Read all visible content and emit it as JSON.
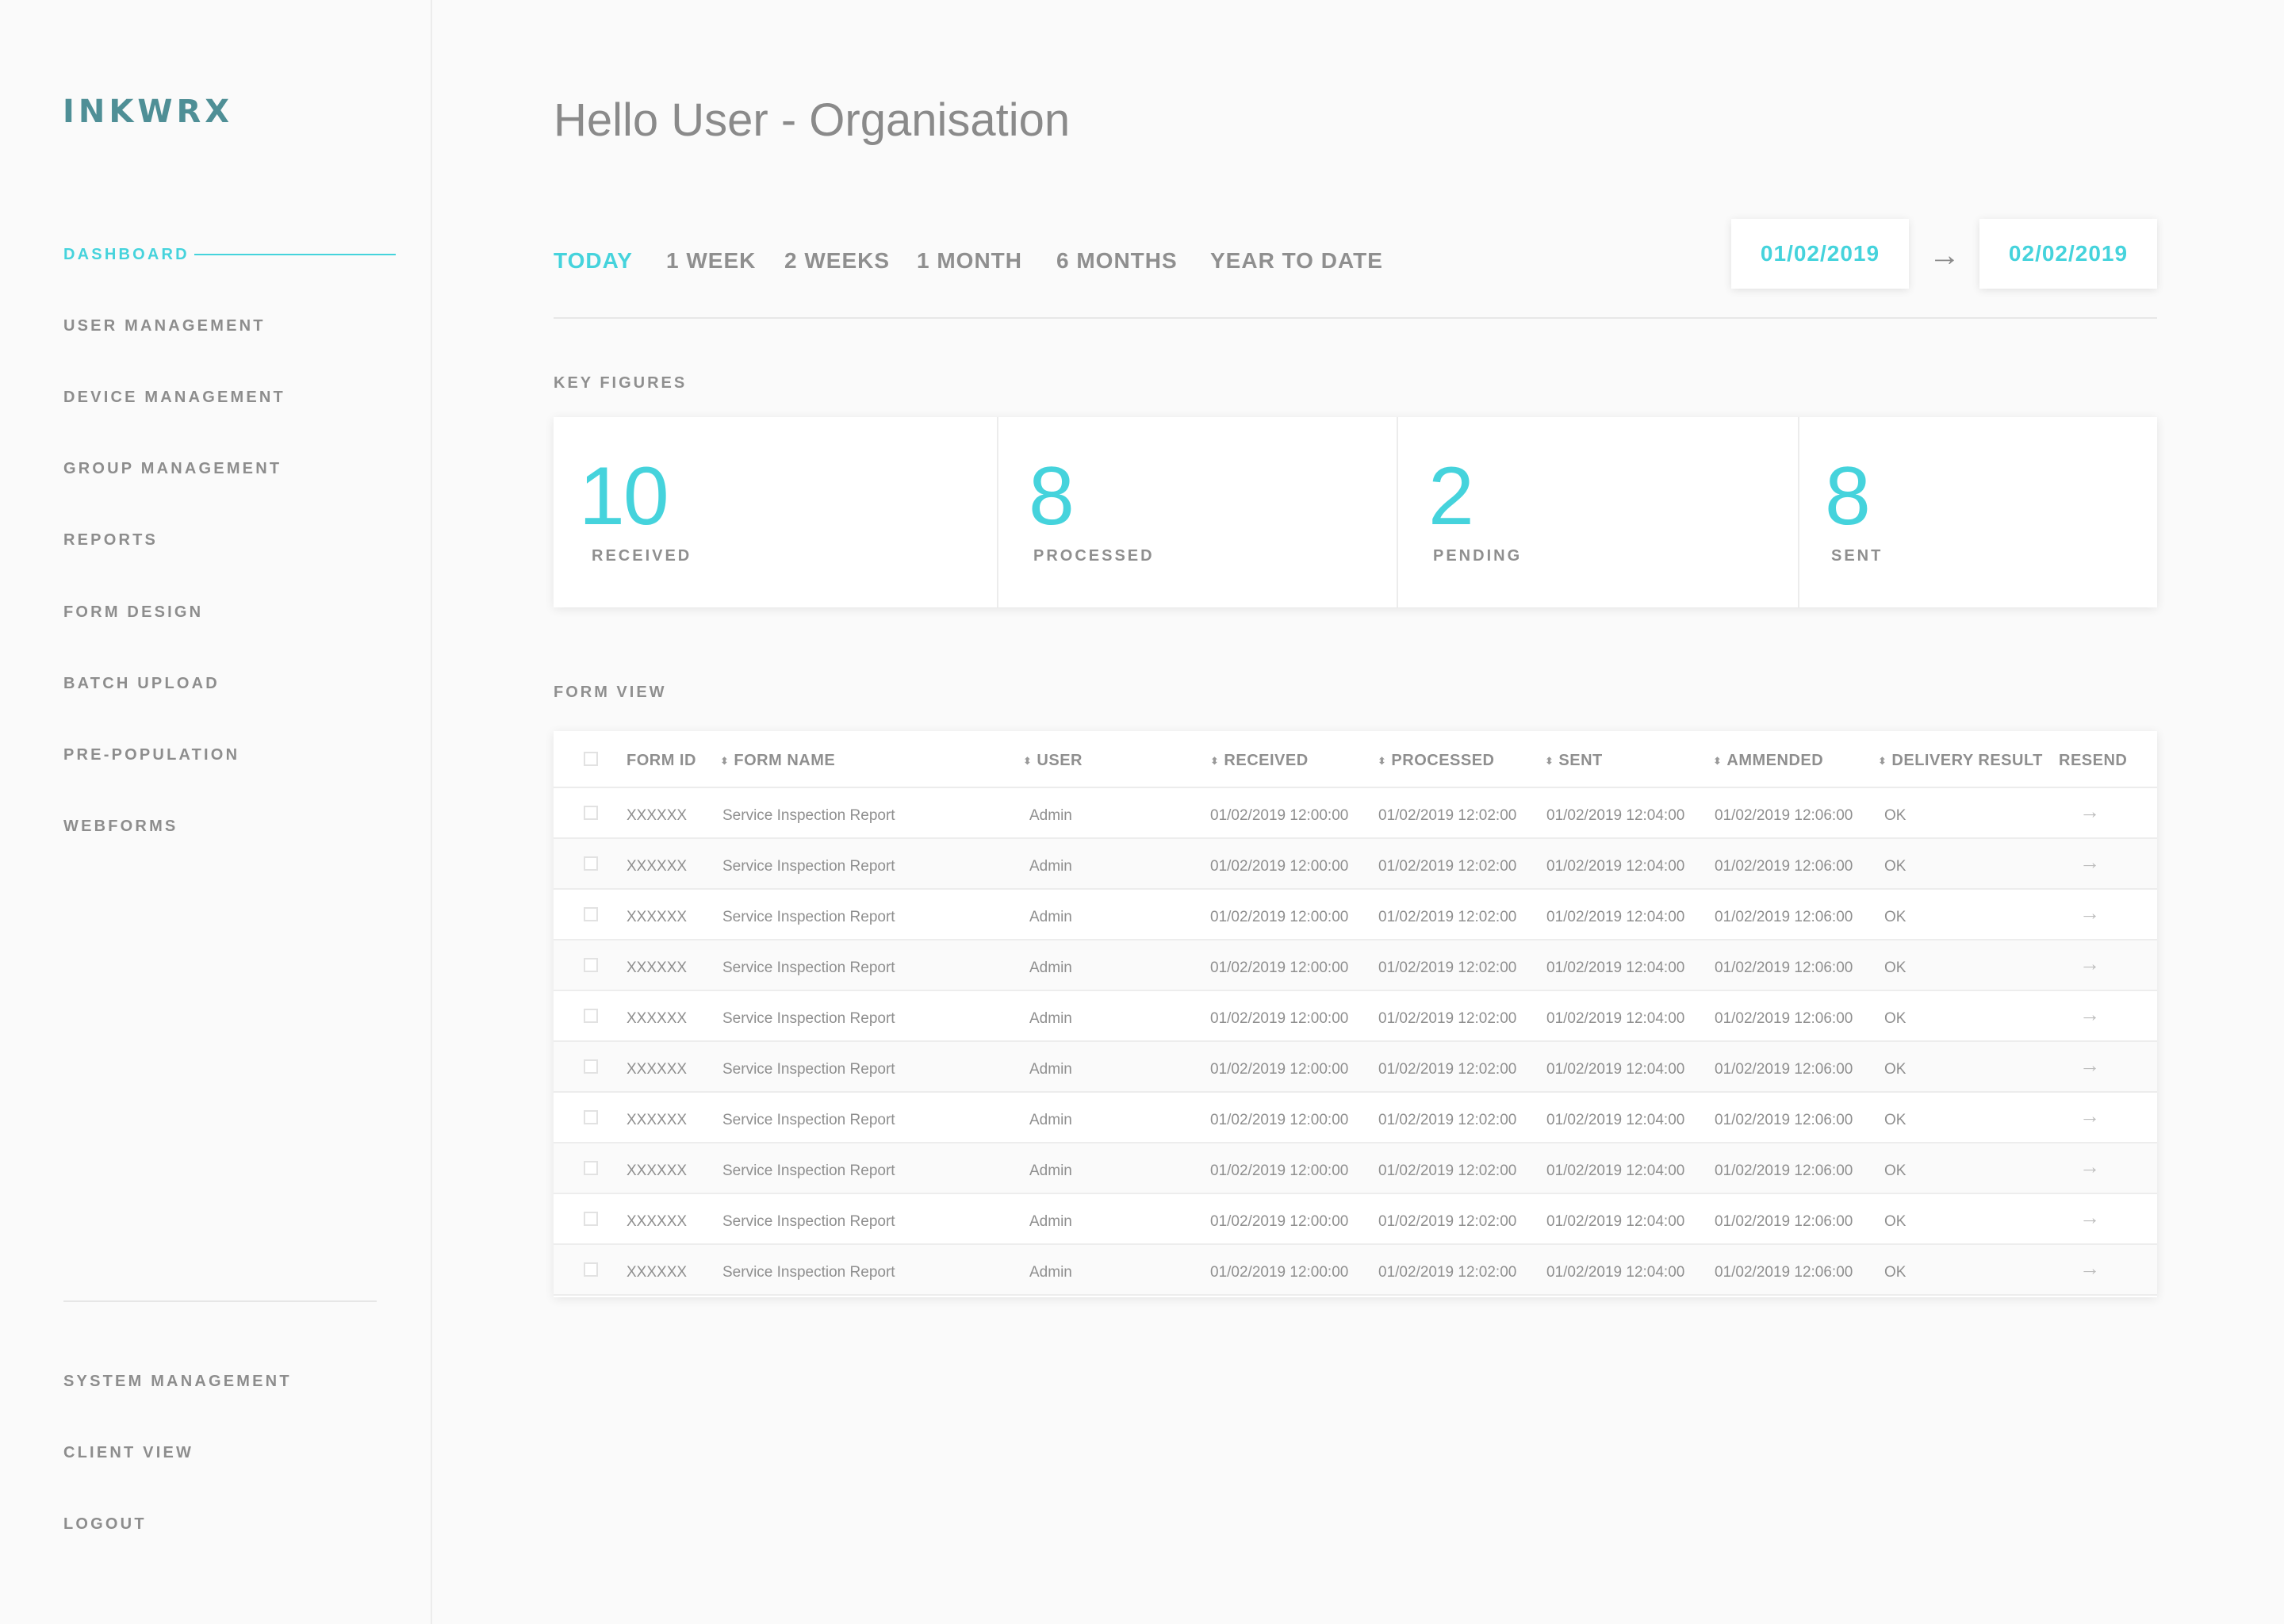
{
  "brand": {
    "logo": "INKWRX"
  },
  "sidebar": {
    "items": [
      {
        "label": "DASHBOARD",
        "active": true
      },
      {
        "label": "USER MANAGEMENT"
      },
      {
        "label": "DEVICE MANAGEMENT"
      },
      {
        "label": "GROUP MANAGEMENT"
      },
      {
        "label": "REPORTS"
      },
      {
        "label": "FORM DESIGN"
      },
      {
        "label": "BATCH UPLOAD"
      },
      {
        "label": "PRE-POPULATION"
      },
      {
        "label": "WEBFORMS"
      }
    ],
    "bottom_items": [
      {
        "label": "SYSTEM MANAGEMENT"
      },
      {
        "label": "CLIENT VIEW"
      },
      {
        "label": "LOGOUT"
      }
    ]
  },
  "header": {
    "greeting": "Hello User - Organisation"
  },
  "periods": [
    "TODAY",
    "1 WEEK",
    "2 WEEKS",
    "1 MONTH",
    "6 MONTHS",
    "YEAR TO DATE"
  ],
  "active_period": "TODAY",
  "date_range": {
    "from": "01/02/2019",
    "arrow": "→",
    "to": "02/02/2019"
  },
  "key_figures": {
    "title": "KEY FIGURES",
    "items": [
      {
        "value": "10",
        "label": "RECEIVED"
      },
      {
        "value": "8",
        "label": "PROCESSED"
      },
      {
        "value": "2",
        "label": "PENDING"
      },
      {
        "value": "8",
        "label": "SENT"
      }
    ]
  },
  "form_view": {
    "title": "FORM VIEW",
    "columns": [
      "FORM ID",
      "FORM NAME",
      "USER",
      "RECEIVED",
      "PROCESSED",
      "SENT",
      "AMMENDED",
      "DELIVERY RESULT",
      "RESEND"
    ],
    "rows": [
      [
        "XXXXXX",
        "Service Inspection Report",
        "Admin",
        "01/02/2019 12:00:00",
        "01/02/2019 12:02:00",
        "01/02/2019 12:04:00",
        "01/02/2019 12:06:00",
        "OK"
      ],
      [
        "XXXXXX",
        "Service Inspection Report",
        "Admin",
        "01/02/2019 12:00:00",
        "01/02/2019 12:02:00",
        "01/02/2019 12:04:00",
        "01/02/2019 12:06:00",
        "OK"
      ],
      [
        "XXXXXX",
        "Service Inspection Report",
        "Admin",
        "01/02/2019 12:00:00",
        "01/02/2019 12:02:00",
        "01/02/2019 12:04:00",
        "01/02/2019 12:06:00",
        "OK"
      ],
      [
        "XXXXXX",
        "Service Inspection Report",
        "Admin",
        "01/02/2019 12:00:00",
        "01/02/2019 12:02:00",
        "01/02/2019 12:04:00",
        "01/02/2019 12:06:00",
        "OK"
      ],
      [
        "XXXXXX",
        "Service Inspection Report",
        "Admin",
        "01/02/2019 12:00:00",
        "01/02/2019 12:02:00",
        "01/02/2019 12:04:00",
        "01/02/2019 12:06:00",
        "OK"
      ],
      [
        "XXXXXX",
        "Service Inspection Report",
        "Admin",
        "01/02/2019 12:00:00",
        "01/02/2019 12:02:00",
        "01/02/2019 12:04:00",
        "01/02/2019 12:06:00",
        "OK"
      ],
      [
        "XXXXXX",
        "Service Inspection Report",
        "Admin",
        "01/02/2019 12:00:00",
        "01/02/2019 12:02:00",
        "01/02/2019 12:04:00",
        "01/02/2019 12:06:00",
        "OK"
      ],
      [
        "XXXXXX",
        "Service Inspection Report",
        "Admin",
        "01/02/2019 12:00:00",
        "01/02/2019 12:02:00",
        "01/02/2019 12:04:00",
        "01/02/2019 12:06:00",
        "OK"
      ],
      [
        "XXXXXX",
        "Service Inspection Report",
        "Admin",
        "01/02/2019 12:00:00",
        "01/02/2019 12:02:00",
        "01/02/2019 12:04:00",
        "01/02/2019 12:06:00",
        "OK"
      ],
      [
        "XXXXXX",
        "Service Inspection Report",
        "Admin",
        "01/02/2019 12:00:00",
        "01/02/2019 12:02:00",
        "01/02/2019 12:04:00",
        "01/02/2019 12:06:00",
        "OK"
      ]
    ],
    "resend_icon": "→"
  },
  "colors": {
    "accent": "#45d3dc",
    "logo": "#4f8f96",
    "text": "#8f8f8f"
  },
  "icons": {
    "sort": "sort-icon",
    "resend": "arrow-right-icon",
    "date_arrow": "arrow-right-icon"
  }
}
